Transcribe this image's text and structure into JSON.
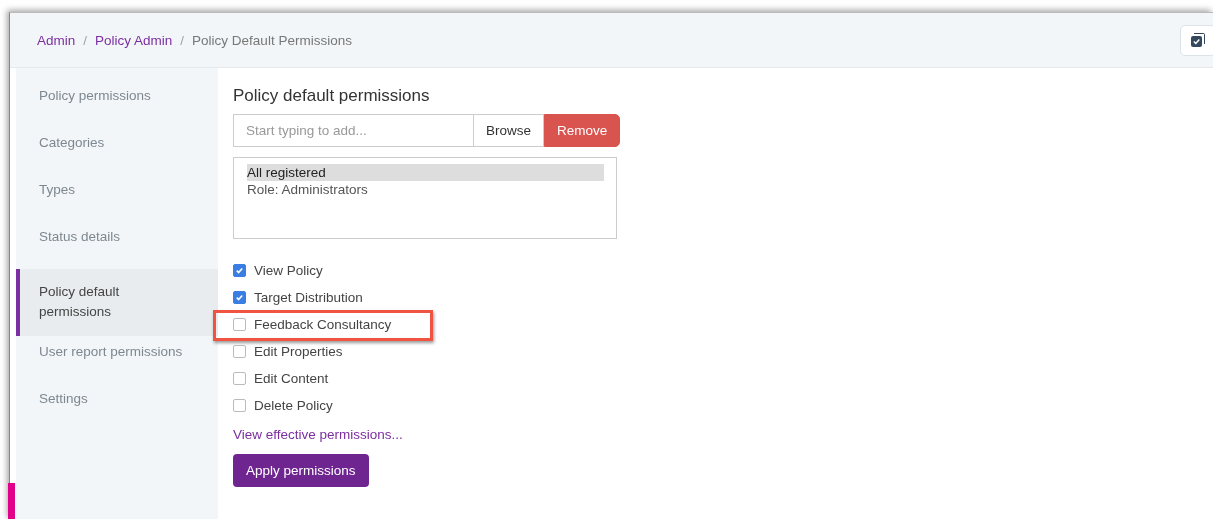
{
  "breadcrumb": {
    "separator": "/",
    "items": [
      {
        "label": "Admin",
        "kind": "link"
      },
      {
        "label": "Policy Admin",
        "kind": "link"
      },
      {
        "label": "Policy Default Permissions",
        "kind": "current"
      }
    ]
  },
  "sidebar": {
    "items": [
      {
        "label": "Policy permissions",
        "selected": false
      },
      {
        "label": "Categories",
        "selected": false
      },
      {
        "label": "Types",
        "selected": false
      },
      {
        "label": "Status details",
        "selected": false
      },
      {
        "label": "Policy default permissions",
        "selected": true
      },
      {
        "label": "User report permissions",
        "selected": false
      },
      {
        "label": "Settings",
        "selected": false
      }
    ]
  },
  "main": {
    "title": "Policy default permissions",
    "search": {
      "placeholder": "Start typing to add..."
    },
    "buttons": [
      {
        "label": "Browse",
        "kind": "default"
      },
      {
        "label": "Remove",
        "kind": "danger"
      }
    ],
    "principals": [
      {
        "label": "All registered",
        "selected": true
      },
      {
        "label": "Role: Administrators",
        "selected": false
      }
    ],
    "permissions": [
      {
        "label": "View Policy",
        "checked": true,
        "highlighted": false
      },
      {
        "label": "Target Distribution",
        "checked": true,
        "highlighted": false
      },
      {
        "label": "Feedback Consultancy",
        "checked": false,
        "highlighted": true
      },
      {
        "label": "Edit Properties",
        "checked": false,
        "highlighted": false
      },
      {
        "label": "Edit Content",
        "checked": false,
        "highlighted": false
      },
      {
        "label": "Delete Policy",
        "checked": false,
        "highlighted": false
      }
    ],
    "link": "View effective permissions...",
    "apply_button": "Apply permissions"
  }
}
